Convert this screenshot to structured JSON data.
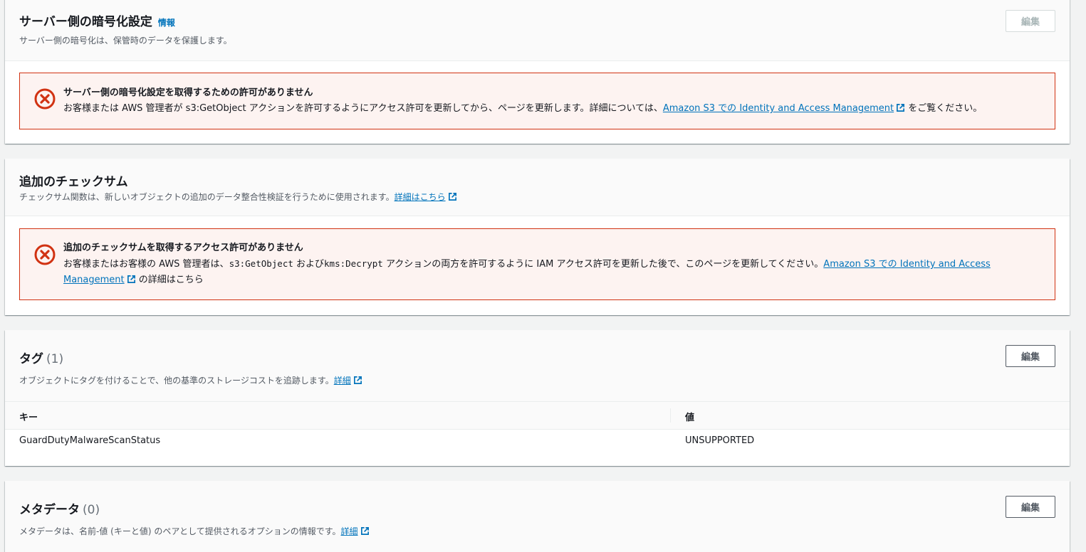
{
  "encryption": {
    "title": "サーバー側の暗号化設定",
    "info_link": "情報",
    "description": "サーバー側の暗号化は、保管時のデータを保護します。",
    "edit_label": "編集",
    "alert": {
      "title": "サーバー側の暗号化設定を取得するための許可がありません",
      "text_before": "お客様または AWS 管理者が s3:GetObject アクションを許可するようにアクセス許可を更新してから、ページを更新します。詳細については、",
      "link": "Amazon S3 での Identity and Access Management",
      "text_after": "をご覧ください。"
    }
  },
  "checksum": {
    "title": "追加のチェックサム",
    "description": "チェックサム関数は、新しいオブジェクトの追加のデータ整合性検証を行うために使用されます。",
    "learn_more": "詳細はこちら",
    "alert": {
      "title": "追加のチェックサムを取得するアクセス許可がありません",
      "text1": "お客様またはお客様の AWS 管理者は、",
      "code1": "s3:GetObject",
      "text2": " および",
      "code2": "kms:Decrypt",
      "text3": " アクションの両方を許可するように IAM アクセス許可を更新した後で、このページを更新してください。",
      "link": "Amazon S3 での Identity and Access Management",
      "text_after": "の詳細はこちら"
    }
  },
  "tags": {
    "title": "タグ",
    "count": "(1)",
    "description": "オブジェクトにタグを付けることで、他の基準のストレージコストを追跡します。",
    "learn_more": "詳細",
    "edit_label": "編集",
    "columns": [
      "キー",
      "値"
    ],
    "rows": [
      {
        "key": "GuardDutyMalwareScanStatus",
        "value": "UNSUPPORTED"
      }
    ]
  },
  "metadata": {
    "title": "メタデータ",
    "count": "(0)",
    "description": "メタデータは、名前-値 (キーと値) のペアとして提供されるオプションの情報です。",
    "learn_more": "詳細",
    "edit_label": "編集"
  },
  "icons": {
    "error": "error-circle-x-icon",
    "external": "external-link-icon"
  },
  "colors": {
    "link": "#0073bb",
    "error_border": "#d13212",
    "error_bg": "#fdf3f1"
  }
}
